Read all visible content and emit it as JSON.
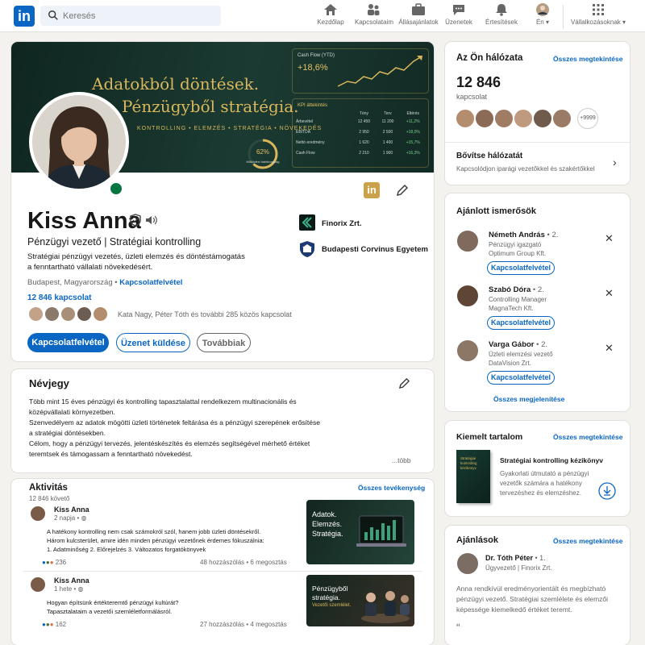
{
  "nav": {
    "search_placeholder": "Keresés",
    "items": [
      {
        "label": "Kezdőlap",
        "icon": "home-icon"
      },
      {
        "label": "Kapcsolataim",
        "icon": "network-icon"
      },
      {
        "label": "Állásajánlatok",
        "icon": "briefcase-icon"
      },
      {
        "label": "Üzenetek",
        "icon": "messages-icon"
      },
      {
        "label": "Értesítések",
        "icon": "bell-icon"
      },
      {
        "label": "Én",
        "icon": "me-avatar"
      },
      {
        "label": "Vállalkozásoknak",
        "icon": "grid-icon"
      }
    ]
  },
  "banner": {
    "line1": "Adatokból döntések.",
    "line2": "Pénzügyből stratégia.",
    "tagline": "KONTROLLING • ELEMZÉS • STRATÉGIA • NÖVEKEDÉS",
    "cashflow_title": "Cash Flow (YTD)",
    "cashflow_value": "+18,6%",
    "kpi_title": "KPI áttekintés",
    "kpi_headers": [
      "",
      "Tény",
      "Terv",
      "Eltérés"
    ],
    "kpi_rows": [
      [
        "Árbevétel",
        "12 450",
        "11 200",
        "+11,2%"
      ],
      [
        "EBITDA",
        "2 950",
        "2 500",
        "+18,0%"
      ],
      [
        "Nettó eredmény",
        "1 620",
        "1 400",
        "+15,7%"
      ],
      [
        "Cash Flow",
        "2 210",
        "1 900",
        "+16,3%"
      ]
    ],
    "gauge_value": "62%",
    "gauge_label": "Működési hatékonyság"
  },
  "profile": {
    "name": "Kiss Anna",
    "headline": "Pénzügyi vezető | Stratégiai kontrolling",
    "about_short_1": "Stratégiai pénzügyi vezetés, üzleti elemzés és döntéstámogatás",
    "about_short_2": "a fenntartható vállalati növekedésért.",
    "location": "Budapest, Magyarország",
    "contact_link": "Kapcsolatfelvétel",
    "connections": "12 846 kapcsolat",
    "mutual": "Kata Nagy, Péter Tóth és további 285 közös kapcsolat",
    "company": "Finorix Zrt.",
    "school": "Budapesti Corvinus Egyetem",
    "btn_connect": "Kapcsolatfelvétel",
    "btn_message": "Üzenet küldése",
    "btn_more": "Továbbiak"
  },
  "about": {
    "title": "Névjegy",
    "p1a": "Több mint 15 éves pénzügyi és kontrolling tapasztalattal rendelkezem multinacionális és",
    "p1b": "középvállalati környezetben.",
    "p2a": "Szenvedélyem az adatok mögötti üzleti történetek feltárása és a pénzügyi szerepének erősítése",
    "p2b": "a stratégiai döntésekben.",
    "p3a": "Célom, hogy a pénzügyi tervezés, jelentéskészítés és elemzés segítségével mérhető értéket",
    "p3b": "teremtsek és támogassam a fenntartható növekedést.",
    "more": "...több"
  },
  "activity": {
    "title": "Aktivitás",
    "followers": "12 846 követő",
    "all_link": "Összes tevékenység",
    "posts": [
      {
        "author": "Kiss Anna",
        "time": "2 napja",
        "line1": "A hatékony kontrolling nem csak számokról szól, hanem jobb üzleti döntésekről.",
        "line2": "Három kulcsterület, amire idén minden pénzügyi vezetőnek érdemes fókuszálnia:",
        "line3": "1. Adatminőség   2. Előrejelzés   3. Változatos forgatókönyvek",
        "reactions": "236",
        "stats": "48 hozzászólás  •  6 megosztás",
        "thumb_text": "Adatok.\nElemzés.\nStratégia."
      },
      {
        "author": "Kiss Anna",
        "time": "1 hete",
        "line1": "Hogyan építsünk értékteremtő pénzügyi kultúrát?",
        "line2": "Tapasztalataim a vezetői szemléletformálásról.",
        "line3": "",
        "reactions": "162",
        "stats": "27 hozzászólás  •  4 megosztás",
        "thumb_text": "Pénzügyből\nstratégia.",
        "thumb_sub": "Vezetői szemlélet."
      }
    ]
  },
  "network": {
    "title": "Az Ön hálózata",
    "all_link": "Összes megtekintése",
    "count": "12 846",
    "count_label": "kapcsolat",
    "more_badge": "+9999",
    "expand_title": "Bővítse hálózatát",
    "expand_sub": "Kapcsolódjon iparági vezetőkkel és szakértőkkel"
  },
  "suggested": {
    "title": "Ajánlott ismerősök",
    "people": [
      {
        "name": "Németh András",
        "degree": "• 2.",
        "role": "Pénzügyi igazgató",
        "company": "Optimum Group Kft.",
        "btn": "Kapcsolatfelvétel"
      },
      {
        "name": "Szabó Dóra",
        "degree": "• 2.",
        "role": "Controlling Manager",
        "company": "MagnaTech Kft.",
        "btn": "Kapcsolatfelvétel"
      },
      {
        "name": "Varga Gábor",
        "degree": "• 2.",
        "role": "Üzleti elemzési vezető",
        "company": "DataVision Zrt.",
        "btn": "Kapcsolatfelvétel"
      }
    ],
    "show_all": "Összes megjelenítése"
  },
  "featured": {
    "title": "Kiemelt tartalom",
    "all_link": "Összes megtekintése",
    "book_cover": "Stratégiai kontrolling kézikönyv",
    "item_title": "Stratégiai kontrolling kézikönyv",
    "desc1": "Gyakorlati útmutató a pénzügyi",
    "desc2": "vezetők számára a hatékony",
    "desc3": "tervezéshez és elemzéshez."
  },
  "recommendations": {
    "title": "Ajánlások",
    "all_link": "Összes megtekintése",
    "name": "Dr. Tóth Péter",
    "degree": "• 1.",
    "role": "Ügyvezető | Finorix Zrt.",
    "text1": "Anna rendkívül eredményorientált és megbízható",
    "text2": "pénzügyi vezető. Stratégiai szemlélete és elemzői",
    "text3": "képessége kiemelkedő értéket teremt."
  },
  "colors": {
    "brand": "#0a66c2",
    "banner_bg": "#16302a",
    "gold": "#c9a24a",
    "online": "#057642"
  }
}
